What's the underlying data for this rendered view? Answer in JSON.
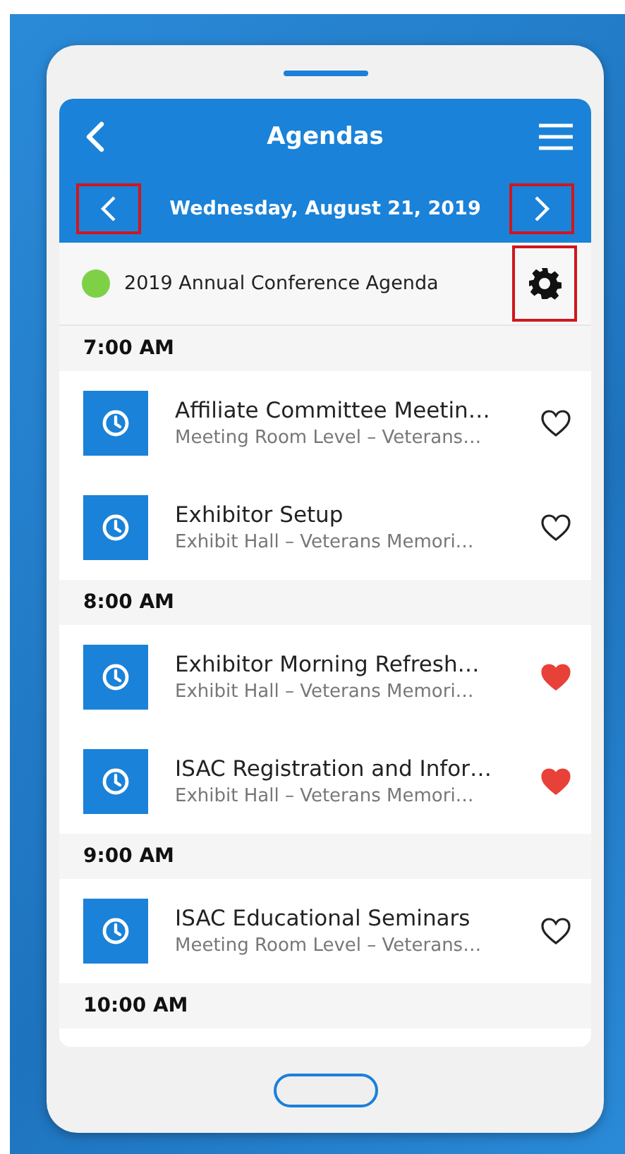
{
  "header": {
    "title": "Agendas"
  },
  "date_bar": {
    "date": "Wednesday, August 21, 2019",
    "prev": {
      "highlighted": true
    },
    "next": {
      "highlighted": true
    }
  },
  "agenda": {
    "name": "2019 Annual Conference Agenda",
    "color": "#7ed147",
    "settings": {
      "highlighted": true
    }
  },
  "groups": [
    {
      "time": "7:00 AM",
      "sessions": [
        {
          "title": "Affiliate Committee Meetin…",
          "location": "Meeting Room Level – Veterans…",
          "favorite": false
        },
        {
          "title": "Exhibitor Setup",
          "location": "Exhibit Hall – Veterans Memori…",
          "favorite": false
        }
      ]
    },
    {
      "time": "8:00 AM",
      "sessions": [
        {
          "title": "Exhibitor Morning Refresh…",
          "location": "Exhibit Hall – Veterans Memori…",
          "favorite": true
        },
        {
          "title": "ISAC Registration and Infor…",
          "location": "Exhibit Hall – Veterans Memori…",
          "favorite": true
        }
      ]
    },
    {
      "time": "9:00 AM",
      "sessions": [
        {
          "title": "ISAC Educational Seminars",
          "location": "Meeting Room Level – Veterans…",
          "favorite": false
        }
      ]
    },
    {
      "time": "10:00 AM"
    }
  ]
}
